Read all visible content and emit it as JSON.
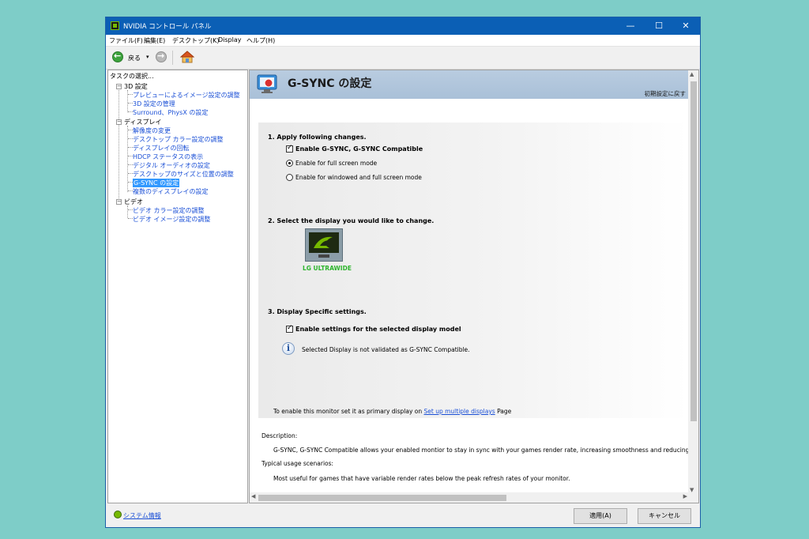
{
  "window": {
    "title": "NVIDIA コントロール パネル",
    "controls": {
      "minimize": "—",
      "maximize": "☐",
      "close": "✕"
    }
  },
  "menu": [
    "ファイル(F)",
    "編集(E)",
    "デスクトップ(K)",
    "Display",
    "ヘルプ(H)"
  ],
  "toolbar": {
    "back_label": "戻る",
    "dropdown_arrow": "▾"
  },
  "tree": {
    "header": "タスクの選択...",
    "groups": [
      {
        "label": "3D 設定",
        "expander": "−",
        "items": [
          "プレビューによるイメージ設定の調整",
          "3D 設定の管理",
          "Surround、PhysX の設定"
        ]
      },
      {
        "label": "ディスプレイ",
        "expander": "−",
        "items": [
          "解像度の変更",
          "デスクトップ カラー設定の調整",
          "ディスプレイの回転",
          "HDCP ステータスの表示",
          "デジタル オーディオの設定",
          "デスクトップのサイズと位置の調整",
          "G-SYNC の設定",
          "複数のディスプレイの設定"
        ]
      },
      {
        "label": "ビデオ",
        "expander": "−",
        "items": [
          "ビデオ カラー設定の調整",
          "ビデオ イメージ設定の調整"
        ]
      }
    ],
    "selected": "G-SYNC の設定"
  },
  "page": {
    "title": "G-SYNC の設定",
    "restore_defaults": "初期設定に戻す",
    "section1": {
      "heading": "1. Apply following changes.",
      "checkbox_label": "Enable G-SYNC, G-SYNC Compatible",
      "checkbox_checked": true,
      "radio_full": "Enable for full screen mode",
      "radio_windowed": "Enable for windowed and full screen mode",
      "selected_radio": "Enable for full screen mode"
    },
    "section2": {
      "heading": "2. Select the display you would like to change.",
      "display_name": "LG ULTRAWIDE"
    },
    "section3": {
      "heading": "3. Display Specific settings.",
      "checkbox_label": "Enable settings for the selected display model",
      "checkbox_checked": true,
      "info_text": "Selected Display is not validated as G-SYNC Compatible."
    },
    "primary_note": {
      "prefix": "To enable this monitor set it as primary display on",
      "link": "Set up multiple displays",
      "suffix": "Page"
    },
    "description": {
      "label": "Description:",
      "text": "G-SYNC, G-SYNC Compatible allows your enabled montior to stay in sync with your games render rate, increasing smoothness and reducing latency.",
      "usage_label": "Typical usage scenarios:",
      "usage_text": "Most useful for games that have variable render rates below the peak refresh rates of your monitor."
    }
  },
  "footer": {
    "system_info": "システム情報",
    "apply": "適用(A)",
    "cancel": "キャンセル"
  },
  "colors": {
    "titlebar": "#0b5fb5",
    "banner": "#b9cce0",
    "link": "#1a4fd6",
    "nvidia_green": "#76b900",
    "selection": "#3399ff"
  }
}
